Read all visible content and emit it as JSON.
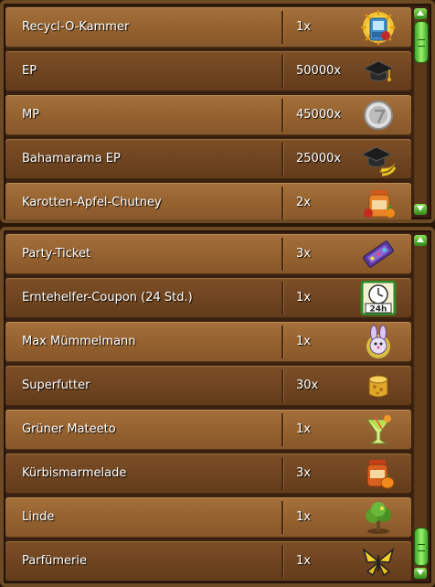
{
  "top_list": {
    "items": [
      {
        "name": "Recycl-O-Kammer",
        "qty": "1x",
        "icon": "recycling-chamber-icon"
      },
      {
        "name": "EP",
        "qty": "50000x",
        "icon": "graduation-cap-icon"
      },
      {
        "name": "MP",
        "qty": "45000x",
        "icon": "silver-coin-icon"
      },
      {
        "name": "Bahamarama EP",
        "qty": "25000x",
        "icon": "graduation-cap-banana-icon"
      },
      {
        "name": "Karotten-Apfel-Chutney",
        "qty": "2x",
        "icon": "chutney-jar-icon"
      }
    ]
  },
  "bottom_list": {
    "items": [
      {
        "name": "Party-Ticket",
        "qty": "3x",
        "icon": "party-ticket-icon"
      },
      {
        "name": "Erntehelfer-Coupon (24 Std.)",
        "qty": "1x",
        "icon": "clock-coupon-icon",
        "icon_label": "24h"
      },
      {
        "name": "Max Mümmelmann",
        "qty": "1x",
        "icon": "bunny-icon"
      },
      {
        "name": "Superfutter",
        "qty": "30x",
        "icon": "superfood-icon"
      },
      {
        "name": "Grüner Mateeto",
        "qty": "1x",
        "icon": "cocktail-glass-icon"
      },
      {
        "name": "Kürbismarmelade",
        "qty": "3x",
        "icon": "pumpkin-jam-icon"
      },
      {
        "name": "Linde",
        "qty": "1x",
        "icon": "linden-tree-icon"
      },
      {
        "name": "Parfümerie",
        "qty": "1x",
        "icon": "butterfly-icon"
      }
    ]
  },
  "colors": {
    "text": "#ffffff",
    "row_light": "#94612f",
    "row_dark": "#6e4420",
    "frame": "#6b4a24",
    "scroll_green": "#3aa52a"
  }
}
